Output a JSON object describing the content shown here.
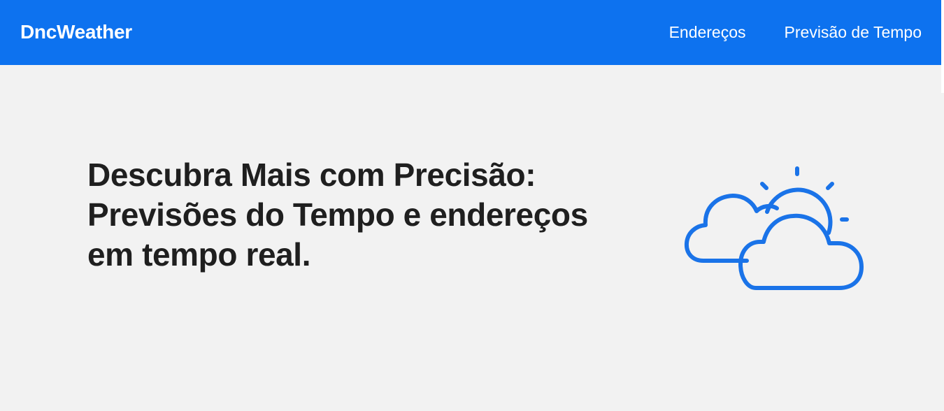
{
  "header": {
    "brand": "DncWeather",
    "nav": [
      {
        "label": "Endereços"
      },
      {
        "label": "Previsão de Tempo"
      }
    ]
  },
  "hero": {
    "title_lines": [
      "Descubra Mais com Precisão:",
      "Previsões do Tempo e endereços",
      "em tempo real."
    ],
    "icon": "partly-cloudy-icon"
  },
  "colors": {
    "navbar": "#0d72ef",
    "background": "#f2f2f2",
    "text": "#1f1f1f",
    "icon": "#1a73e8"
  }
}
